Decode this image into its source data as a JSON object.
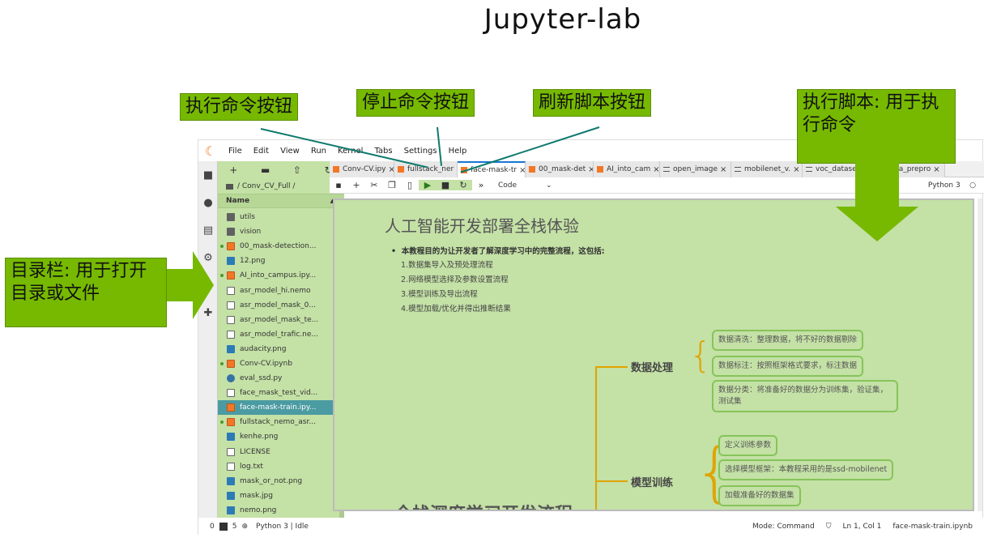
{
  "slide_title": "Jupyter-lab",
  "annotations": {
    "run_button": "执行命令按钮",
    "stop_button": "停止命令按钮",
    "refresh_button": "刷新脚本按钮",
    "run_script": "执行脚本: 用于执行命令",
    "file_browser": "目录栏: 用于打开目录或文件"
  },
  "menubar": [
    "File",
    "Edit",
    "View",
    "Run",
    "Kernel",
    "Tabs",
    "Settings",
    "Help"
  ],
  "file_browser": {
    "path": "/ Conv_CV_Full /",
    "header": "Name",
    "items": [
      {
        "name": "utils",
        "type": "folder",
        "running": false
      },
      {
        "name": "vision",
        "type": "folder",
        "running": false
      },
      {
        "name": "00_mask-detection...",
        "type": "notebook",
        "running": true
      },
      {
        "name": "12.png",
        "type": "image",
        "running": false
      },
      {
        "name": "AI_into_campus.ipy...",
        "type": "notebook",
        "running": true
      },
      {
        "name": "asr_model_hi.nemo",
        "type": "file",
        "running": false
      },
      {
        "name": "asr_model_mask_0...",
        "type": "file",
        "running": false
      },
      {
        "name": "asr_model_mask_te...",
        "type": "file",
        "running": false
      },
      {
        "name": "asr_model_trafic.ne...",
        "type": "file",
        "running": false
      },
      {
        "name": "audacity.png",
        "type": "image",
        "running": false
      },
      {
        "name": "Conv-CV.ipynb",
        "type": "notebook",
        "running": true
      },
      {
        "name": "eval_ssd.py",
        "type": "python",
        "running": false
      },
      {
        "name": "face_mask_test_vid...",
        "type": "file",
        "running": false
      },
      {
        "name": "face-mask-train.ipy...",
        "type": "notebook",
        "running": false,
        "selected": true
      },
      {
        "name": "fullstack_nemo_asr...",
        "type": "notebook",
        "running": true
      },
      {
        "name": "kenhe.png",
        "type": "image",
        "running": false
      },
      {
        "name": "LICENSE",
        "type": "file",
        "running": false
      },
      {
        "name": "log.txt",
        "type": "file",
        "running": false
      },
      {
        "name": "mask_or_not.png",
        "type": "image",
        "running": false
      },
      {
        "name": "mask.jpg",
        "type": "image",
        "running": false
      },
      {
        "name": "nemo.png",
        "type": "image",
        "running": false
      }
    ]
  },
  "tabs": [
    {
      "label": "Conv-CV.ipy",
      "kind": "notebook",
      "active": false
    },
    {
      "label": "fullstack_ner",
      "kind": "notebook",
      "active": false
    },
    {
      "label": "face-mask-tr",
      "kind": "notebook",
      "active": true
    },
    {
      "label": "00_mask-det",
      "kind": "notebook",
      "active": false
    },
    {
      "label": "AI_into_cam",
      "kind": "notebook",
      "active": false
    },
    {
      "label": "open_image",
      "kind": "markdown",
      "active": false
    },
    {
      "label": "mobilenet_v.",
      "kind": "markdown",
      "active": false
    },
    {
      "label": "voc_dataset.",
      "kind": "markdown",
      "active": false
    },
    {
      "label": "data_prepro",
      "kind": "markdown",
      "active": false
    }
  ],
  "notebook_toolbar": {
    "cell_type": "Code",
    "kernel": "Python 3"
  },
  "notebook": {
    "title": "人工智能开发部署全栈体验",
    "lead": "本教程目的为让开发者了解深度学习中的完整流程，这包括:",
    "steps": [
      "1.数据集导入及预处理流程",
      "2.网络模型选择及参数设置流程",
      "3.模型训练及导出流程",
      "4.模型加载/优化并得出推断结果"
    ],
    "mindmap": {
      "data_label": "数据处理",
      "data_items": [
        "数据清洗：整理数据，将不好的数据剔除",
        "数据标注：按照框架格式要求，标注数据",
        "数据分类：将准备好的数据分为训练集，验证集，测试集"
      ],
      "train_label": "模型训练",
      "train_items": [
        "定义训练参数",
        "选择模型框架：本教程采用的是ssd-mobilenet",
        "加载准备好的数据集"
      ],
      "bottom_title": "全栈深度学习开发流程"
    }
  },
  "statusbar": {
    "left0": "0",
    "terminals": "5",
    "kernel_status": "Python 3 | Idle",
    "mode": "Mode: Command",
    "position": "Ln 1, Col 1",
    "filename": "face-mask-train.ipynb"
  }
}
